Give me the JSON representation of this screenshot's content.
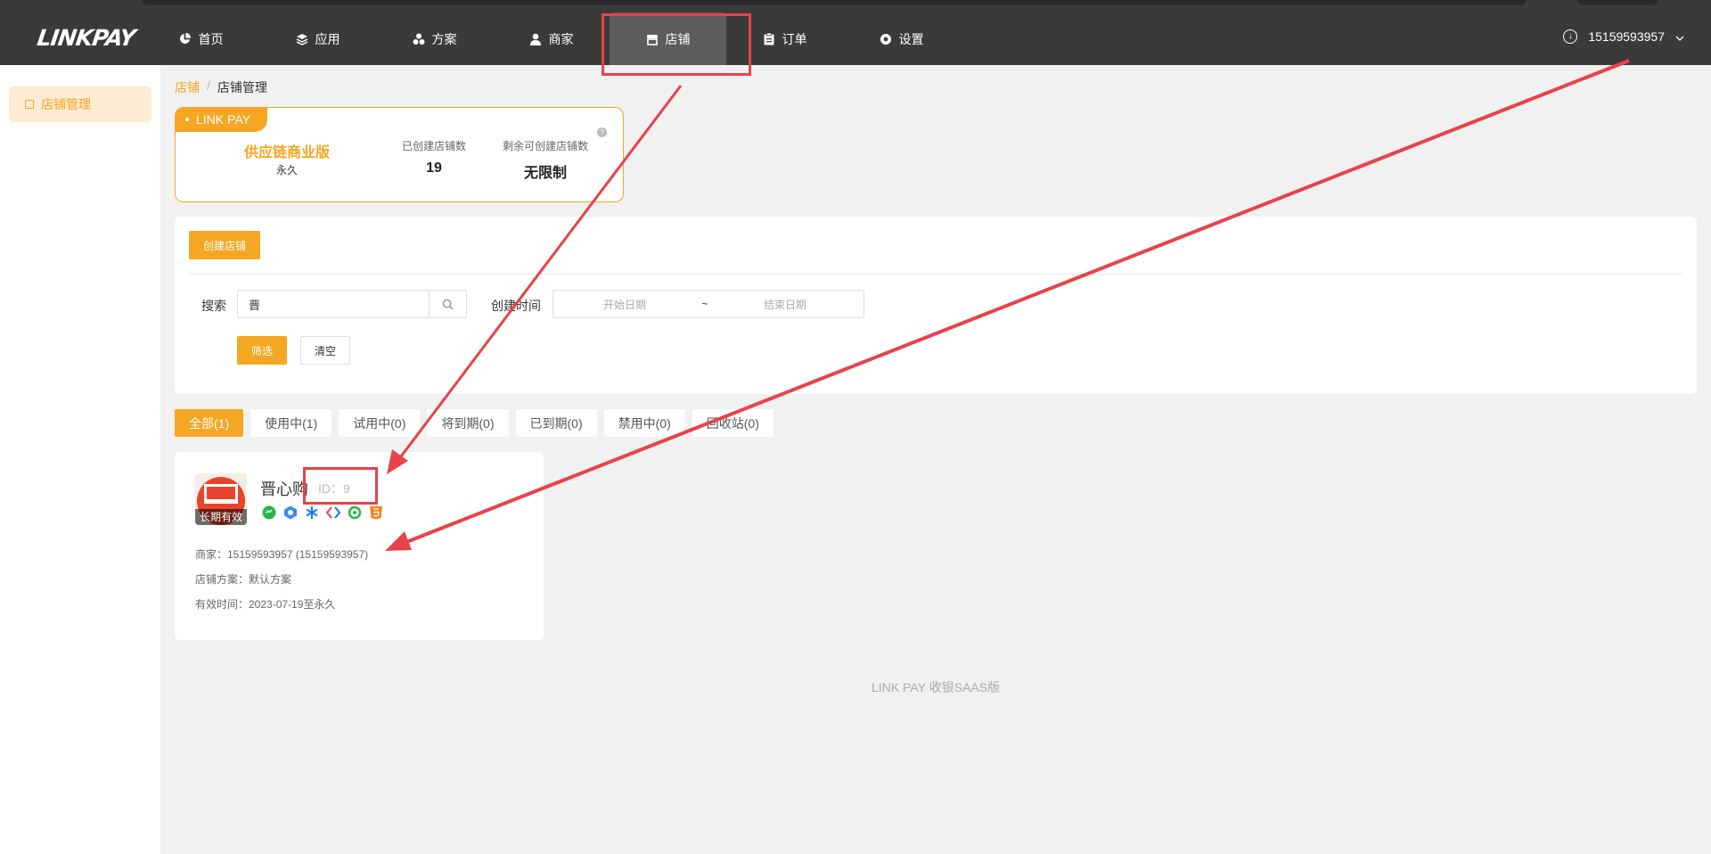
{
  "topbar": {
    "logo": "LINKPAY",
    "nav": [
      {
        "label": "首页",
        "icon": "pie-chart-icon"
      },
      {
        "label": "应用",
        "icon": "layers-icon"
      },
      {
        "label": "方案",
        "icon": "nodes-icon"
      },
      {
        "label": "商家",
        "icon": "user-icon"
      },
      {
        "label": "店铺",
        "icon": "store-icon",
        "active": true
      },
      {
        "label": "订单",
        "icon": "clipboard-icon"
      },
      {
        "label": "设置",
        "icon": "gear-icon"
      }
    ],
    "account": "15159593957"
  },
  "sidebar": {
    "items": [
      {
        "label": "店铺管理",
        "active": true
      }
    ]
  },
  "breadcrumb": {
    "parent": "店铺",
    "separator": "/",
    "current": "店铺管理"
  },
  "license": {
    "badge": "LINK PAY",
    "edition": "供应链商业版",
    "duration": "永久",
    "created_label": "已创建店铺数",
    "created_value": "19",
    "remaining_label": "剩余可创建店铺数",
    "remaining_value": "无限制"
  },
  "filter": {
    "create_button": "创建店铺",
    "search_label": "搜索",
    "search_value": "晋",
    "time_label": "创建时间",
    "start_placeholder": "开始日期",
    "range_separator": "~",
    "end_placeholder": "结束日期",
    "filter_button": "筛选",
    "clear_button": "清空"
  },
  "tabs": [
    {
      "label": "全部(1)",
      "active": true
    },
    {
      "label": "使用中(1)"
    },
    {
      "label": "试用中(0)"
    },
    {
      "label": "将到期(0)"
    },
    {
      "label": "已到期(0)"
    },
    {
      "label": "禁用中(0)"
    },
    {
      "label": "回收站(0)"
    }
  ],
  "store": {
    "name": "晋心购",
    "id": "ID：9",
    "validity_tag": "长期有效",
    "merchant": "商家：15159593957 (15159593957)",
    "plan": "店铺方案：默认方案",
    "valid_time": "有效时间：2023-07-19至永久",
    "platforms": [
      "wechat-icon",
      "miniapp-icon",
      "alipay-icon",
      "code-icon",
      "leaf-icon",
      "html5-icon"
    ]
  },
  "footer": "LINK PAY 收银SAAS版",
  "colors": {
    "accent": "#f5a623",
    "topbar": "#3a3a3a",
    "annotation": "#e8424a"
  }
}
